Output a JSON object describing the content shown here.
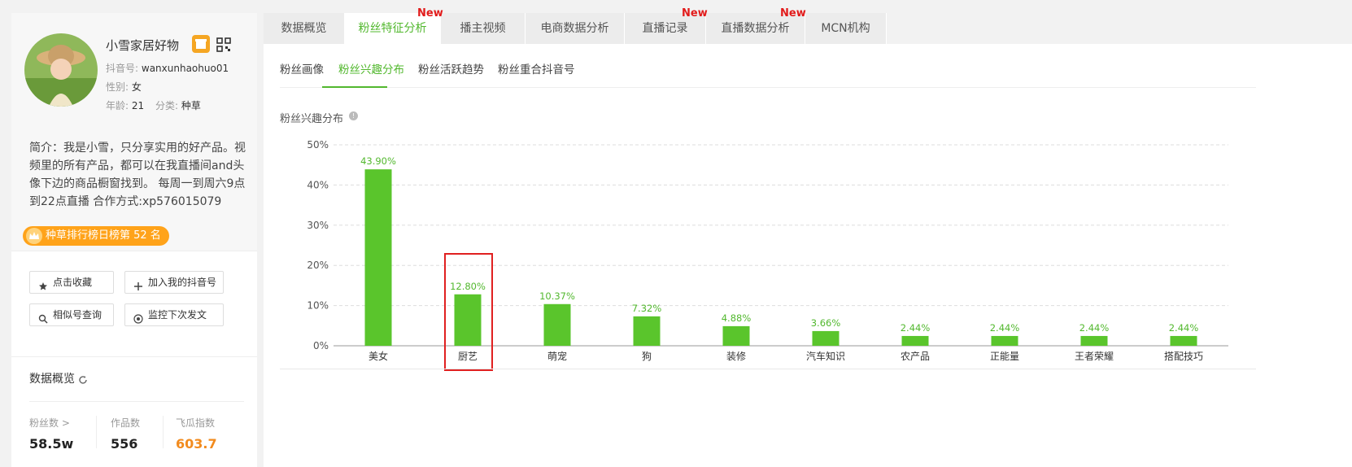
{
  "profile": {
    "nickname": "小雪家居好物",
    "douyin_id_label": "抖音号:",
    "douyin_id": "wanxunhaohuo01",
    "gender_label": "性别:",
    "gender": "女",
    "age_label": "年龄:",
    "age": "21",
    "category_label": "分类:",
    "category": "种草",
    "bio": "简介：我是小雪，只分享实用的好产品。视频里的所有产品，都可以在我直播间and头像下边的商品橱窗找到。 每周一到周六9点到22点直播 合作方式:xp576015079",
    "rank_badge": "种草排行榜日榜第 52 名",
    "icons": [
      "shop-icon",
      "qr-code-icon",
      "crown-icon"
    ]
  },
  "actions": {
    "favorite": "点击收藏",
    "add_account": "加入我的抖音号",
    "similar": "相似号查询",
    "monitor": "监控下次发文"
  },
  "overview": {
    "title": "数据概览",
    "fans_label": "粉丝数 >",
    "fans_value": "58.5w",
    "works_label": "作品数",
    "works_value": "556",
    "index_label": "飞瓜指数",
    "index_value": "603.7"
  },
  "tabs": [
    {
      "label": "数据概览",
      "new": false,
      "active": false
    },
    {
      "label": "粉丝特征分析",
      "new": true,
      "active": true
    },
    {
      "label": "播主视频",
      "new": false,
      "active": false
    },
    {
      "label": "电商数据分析",
      "new": false,
      "active": false
    },
    {
      "label": "直播记录",
      "new": true,
      "active": false
    },
    {
      "label": "直播数据分析",
      "new": true,
      "active": false
    },
    {
      "label": "MCN机构",
      "new": false,
      "active": false
    }
  ],
  "new_badge": "New",
  "subtabs": [
    {
      "label": "粉丝画像",
      "active": false
    },
    {
      "label": "粉丝兴趣分布",
      "active": true
    },
    {
      "label": "粉丝活跃趋势",
      "active": false
    },
    {
      "label": "粉丝重合抖音号",
      "active": false
    }
  ],
  "chart_title": "粉丝兴趣分布",
  "colors": {
    "accent": "#52b82e",
    "bar": "#5ac52c",
    "new": "#e21b1b",
    "highlight": "#e02020",
    "rank": "#ffa31a"
  },
  "chart_data": {
    "type": "bar",
    "title": "粉丝兴趣分布",
    "categories": [
      "美女",
      "厨艺",
      "萌宠",
      "狗",
      "装修",
      "汽车知识",
      "农产品",
      "正能量",
      "王者荣耀",
      "搭配技巧"
    ],
    "values": [
      43.9,
      12.8,
      10.37,
      7.32,
      4.88,
      3.66,
      2.44,
      2.44,
      2.44,
      2.44
    ],
    "labels": [
      "43.90%",
      "12.80%",
      "10.37%",
      "7.32%",
      "4.88%",
      "3.66%",
      "2.44%",
      "2.44%",
      "2.44%",
      "2.44%"
    ],
    "yticks": [
      "0%",
      "10%",
      "20%",
      "30%",
      "40%",
      "50%"
    ],
    "ylim": [
      0,
      50
    ],
    "grid": true,
    "highlighted_category": "厨艺"
  }
}
